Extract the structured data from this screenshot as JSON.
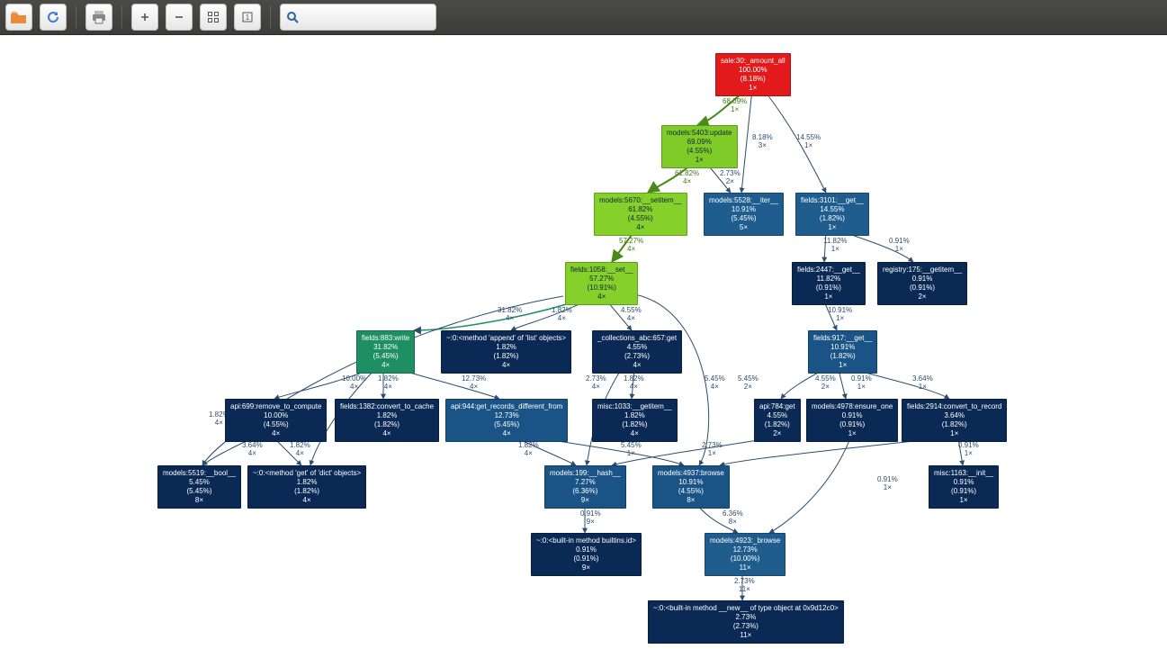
{
  "toolbar": {
    "open": "open-file-icon",
    "refresh": "refresh-icon",
    "print": "print-icon",
    "zoom_in": "zoom-in-icon",
    "zoom_out": "zoom-out-icon",
    "fit": "zoom-fit-icon",
    "reset": "zoom-reset-icon",
    "search_placeholder": ""
  },
  "nodes": {
    "n0": {
      "line1": "sale:30:_amount_all",
      "line2": "100.00%",
      "line3": "(8.18%)",
      "line4": "1×"
    },
    "n1": {
      "line1": "models:5403:update",
      "line2": "69.09%",
      "line3": "(4.55%)",
      "line4": "1×"
    },
    "n2": {
      "line1": "models:5670:__setitem__",
      "line2": "61.82%",
      "line3": "(4.55%)",
      "line4": "4×"
    },
    "n3": {
      "line1": "fields:1058:__set__",
      "line2": "57.27%",
      "line3": "(10.91%)",
      "line4": "4×"
    },
    "n4": {
      "line1": "models:5528:__iter__",
      "line2": "10.91%",
      "line3": "(5.45%)",
      "line4": "5×"
    },
    "n5": {
      "line1": "fields:3101:__get__",
      "line2": "14.55%",
      "line3": "(1.82%)",
      "line4": "1×"
    },
    "n6": {
      "line1": "fields:2447:__get__",
      "line2": "11.82%",
      "line3": "(0.91%)",
      "line4": "1×"
    },
    "n7": {
      "line1": "registry:175:__getitem__",
      "line2": "0.91%",
      "line3": "(0.91%)",
      "line4": "2×"
    },
    "n8": {
      "line1": "fields:917:__get__",
      "line2": "10.91%",
      "line3": "(1.82%)",
      "line4": "1×"
    },
    "n9": {
      "line1": "fields:883:write",
      "line2": "31.82%",
      "line3": "(5.45%)",
      "line4": "4×"
    },
    "n10": {
      "line1": "~:0:<method 'append' of 'list' objects>",
      "line2": "1.82%",
      "line3": "(1.82%)",
      "line4": "4×"
    },
    "n11": {
      "line1": "_collections_abc:657:get",
      "line2": "4.55%",
      "line3": "(2.73%)",
      "line4": "4×"
    },
    "n12": {
      "line1": "api:699:remove_to_compute",
      "line2": "10.00%",
      "line3": "(4.55%)",
      "line4": "4×"
    },
    "n13": {
      "line1": "fields:1382:convert_to_cache",
      "line2": "1.82%",
      "line3": "(1.82%)",
      "line4": "4×"
    },
    "n14": {
      "line1": "api:944:get_records_different_from",
      "line2": "12.73%",
      "line3": "(5.45%)",
      "line4": "4×"
    },
    "n15": {
      "line1": "misc:1033:__getitem__",
      "line2": "1.82%",
      "line3": "(1.82%)",
      "line4": "4×"
    },
    "n16": {
      "line1": "api:784:get",
      "line2": "4.55%",
      "line3": "(1.82%)",
      "line4": "2×"
    },
    "n17": {
      "line1": "models:4978:ensure_one",
      "line2": "0.91%",
      "line3": "(0.91%)",
      "line4": "1×"
    },
    "n18": {
      "line1": "fields:2914:convert_to_record",
      "line2": "3.64%",
      "line3": "(1.82%)",
      "line4": "1×"
    },
    "n19": {
      "line1": "models:5519:__bool__",
      "line2": "5.45%",
      "line3": "(5.45%)",
      "line4": "8×"
    },
    "n20": {
      "line1": "~:0:<method 'get' of 'dict' objects>",
      "line2": "1.82%",
      "line3": "(1.82%)",
      "line4": "4×"
    },
    "n21": {
      "line1": "models:199:__hash__",
      "line2": "7.27%",
      "line3": "(6.36%)",
      "line4": "9×"
    },
    "n22": {
      "line1": "models:4937:browse",
      "line2": "10.91%",
      "line3": "(4.55%)",
      "line4": "8×"
    },
    "n23": {
      "line1": "misc:1163:__init__",
      "line2": "0.91%",
      "line3": "(0.91%)",
      "line4": "1×"
    },
    "n24": {
      "line1": "~:0:<built-in method builtins.id>",
      "line2": "0.91%",
      "line3": "(0.91%)",
      "line4": "9×"
    },
    "n25": {
      "line1": "models:4923:_browse",
      "line2": "12.73%",
      "line3": "(10.00%)",
      "line4": "11×"
    },
    "n26": {
      "line1": "~:0:<built-in method __new__ of type object at 0x9d12c0>",
      "line2": "2.73%",
      "line3": "(2.73%)",
      "line4": "11×"
    }
  },
  "edge_labels": {
    "e0": {
      "pct": "68.09%",
      "cnt": "1×"
    },
    "e1": {
      "pct": "8.18%",
      "cnt": "3×"
    },
    "e2": {
      "pct": "14.55%",
      "cnt": "1×"
    },
    "e3": {
      "pct": "61.82%",
      "cnt": "4×"
    },
    "e4": {
      "pct": "2.73%",
      "cnt": "2×"
    },
    "e5": {
      "pct": "57.27%",
      "cnt": "4×"
    },
    "e6": {
      "pct": "11.82%",
      "cnt": "1×"
    },
    "e7": {
      "pct": "0.91%",
      "cnt": "1×"
    },
    "e8": {
      "pct": "10.91%",
      "cnt": "1×"
    },
    "e9": {
      "pct": "31.82%",
      "cnt": "4×"
    },
    "e10": {
      "pct": "1.82%",
      "cnt": "4×"
    },
    "e11": {
      "pct": "4.55%",
      "cnt": "4×"
    },
    "e12": {
      "pct": "10.00%",
      "cnt": "4×"
    },
    "e13": {
      "pct": "1.82%",
      "cnt": "4×"
    },
    "e14": {
      "pct": "12.73%",
      "cnt": "4×"
    },
    "e15": {
      "pct": "1.82%",
      "cnt": "4×"
    },
    "e16": {
      "pct": "2.73%",
      "cnt": "4×"
    },
    "e17": {
      "pct": "1.82%",
      "cnt": "4×"
    },
    "e18": {
      "pct": "5.45%",
      "cnt": "4×"
    },
    "e19": {
      "pct": "5.45%",
      "cnt": "2×"
    },
    "e20": {
      "pct": "4.55%",
      "cnt": "2×"
    },
    "e21": {
      "pct": "0.91%",
      "cnt": "1×"
    },
    "e22": {
      "pct": "3.64%",
      "cnt": "1×"
    },
    "e23": {
      "pct": "3.64%",
      "cnt": "4×"
    },
    "e24": {
      "pct": "1.82%",
      "cnt": "4×"
    },
    "e25": {
      "pct": "1.82%",
      "cnt": "4×"
    },
    "e26": {
      "pct": "5.45%",
      "cnt": "1×"
    },
    "e27": {
      "pct": "2.73%",
      "cnt": "1×"
    },
    "e28": {
      "pct": "0.91%",
      "cnt": "1×"
    },
    "e29": {
      "pct": "0.91%",
      "cnt": "9×"
    },
    "e30": {
      "pct": "6.36%",
      "cnt": "8×"
    },
    "e31": {
      "pct": "0.91%",
      "cnt": "1×"
    },
    "e32": {
      "pct": "2.73%",
      "cnt": "11×"
    }
  }
}
